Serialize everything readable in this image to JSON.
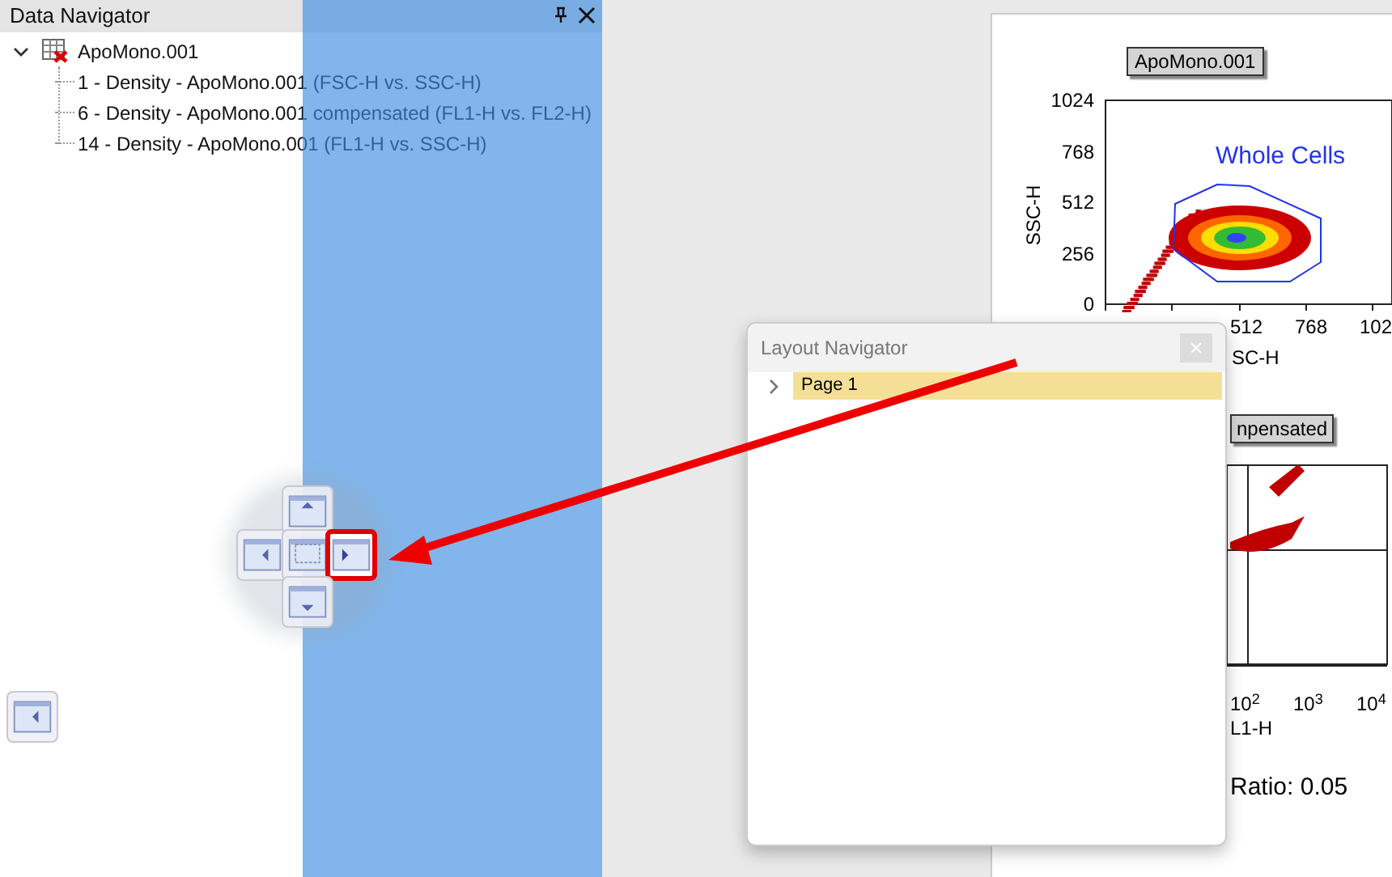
{
  "data_navigator": {
    "title": "Data Navigator",
    "tree": [
      {
        "label": "ApoMono.001",
        "expanded": true,
        "children": [
          {
            "label": "1 - Density - ApoMono.001 (FSC-H vs. SSC-H)"
          },
          {
            "label": "6 - Density - ApoMono.001 compensated (FL1-H vs. FL2-H)"
          },
          {
            "label": "14 - Density - ApoMono.001 (FL1-H vs. SSC-H)"
          }
        ]
      }
    ]
  },
  "dock_guide": [
    {
      "kind": "top",
      "selected": false
    },
    {
      "kind": "left",
      "selected": false
    },
    {
      "kind": "center",
      "selected": false
    },
    {
      "kind": "right",
      "selected": true
    },
    {
      "kind": "bottom",
      "selected": false
    },
    {
      "kind": "edge-left",
      "selected": false
    }
  ],
  "layout_navigator": {
    "title": "Layout Navigator",
    "items": [
      {
        "label": "Page 1",
        "selected": true,
        "expanded": false
      }
    ]
  },
  "plots": [
    {
      "kind": "density",
      "title": "ApoMono.001",
      "ylabel": "SSC-H",
      "yticks": [
        "1024",
        "768",
        "512",
        "256",
        "0"
      ],
      "xticks": [
        "512",
        "768",
        "102"
      ],
      "xlabel": "SC-H",
      "gate_label": "Whole Cells"
    },
    {
      "kind": "quadrant",
      "title": "npensated",
      "xticks": [
        "10$^{2}$",
        "10$^{3}$",
        "10$^{4}$"
      ],
      "xlabel": "L1-H",
      "stat": "Ratio: 0.05"
    }
  ]
}
